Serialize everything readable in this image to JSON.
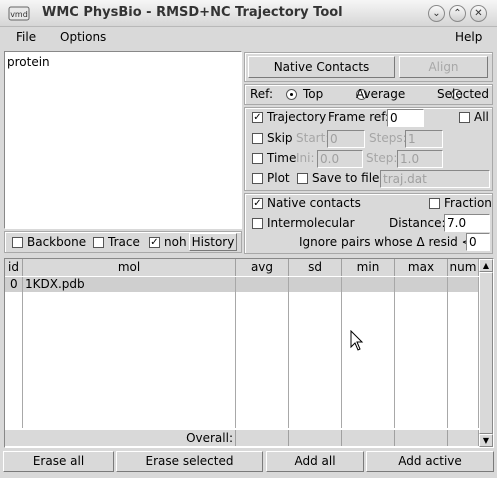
{
  "window": {
    "title": "WMC PhysBio - RMSD+NC Trajectory Tool"
  },
  "menu": {
    "file": "File",
    "options": "Options",
    "help": "Help"
  },
  "selection": {
    "text": "protein"
  },
  "sel_options": {
    "backbone": "Backbone",
    "trace": "Trace",
    "noh": "noh",
    "history": "History",
    "backbone_checked": false,
    "trace_checked": false,
    "noh_checked": true
  },
  "actions": {
    "native_contacts": "Native Contacts",
    "align": "Align"
  },
  "ref": {
    "label": "Ref:",
    "top": "Top",
    "average": "Average",
    "selected": "Selected",
    "selected_value": "Top"
  },
  "trajectory": {
    "trajectory_label": "Trajectory",
    "trajectory_checked": true,
    "frame_ref_label": "Frame ref:",
    "frame_ref_value": "0",
    "all_label": "All",
    "all_checked": false,
    "skip_label": "Skip",
    "start_label": "Start:",
    "start_value": "0",
    "steps_label": "Steps:",
    "steps_value": "1",
    "time_label": "Time",
    "ini_label": "Ini:",
    "ini_value": "0.0",
    "step_label": "Step:",
    "step_value": "1.0",
    "plot_label": "Plot",
    "save_label": "Save to file:",
    "save_value": "traj.dat"
  },
  "nc": {
    "native_label": "Native contacts",
    "native_checked": true,
    "fraction_label": "Fraction",
    "fraction_checked": false,
    "inter_label": "Intermolecular",
    "inter_checked": false,
    "distance_label": "Distance:",
    "distance_value": "7.0",
    "ignore_label": "Ignore pairs whose Δ resid <",
    "ignore_value": "0"
  },
  "table": {
    "columns": [
      "id",
      "mol",
      "avg",
      "sd",
      "min",
      "max",
      "num"
    ],
    "rows": [
      {
        "id": "0",
        "mol": "1KDX.pdb",
        "avg": "",
        "sd": "",
        "min": "",
        "max": "",
        "num": ""
      }
    ],
    "overall_label": "Overall:"
  },
  "bottom": {
    "erase_all": "Erase all",
    "erase_selected": "Erase selected",
    "add_all": "Add all",
    "add_active": "Add active"
  }
}
